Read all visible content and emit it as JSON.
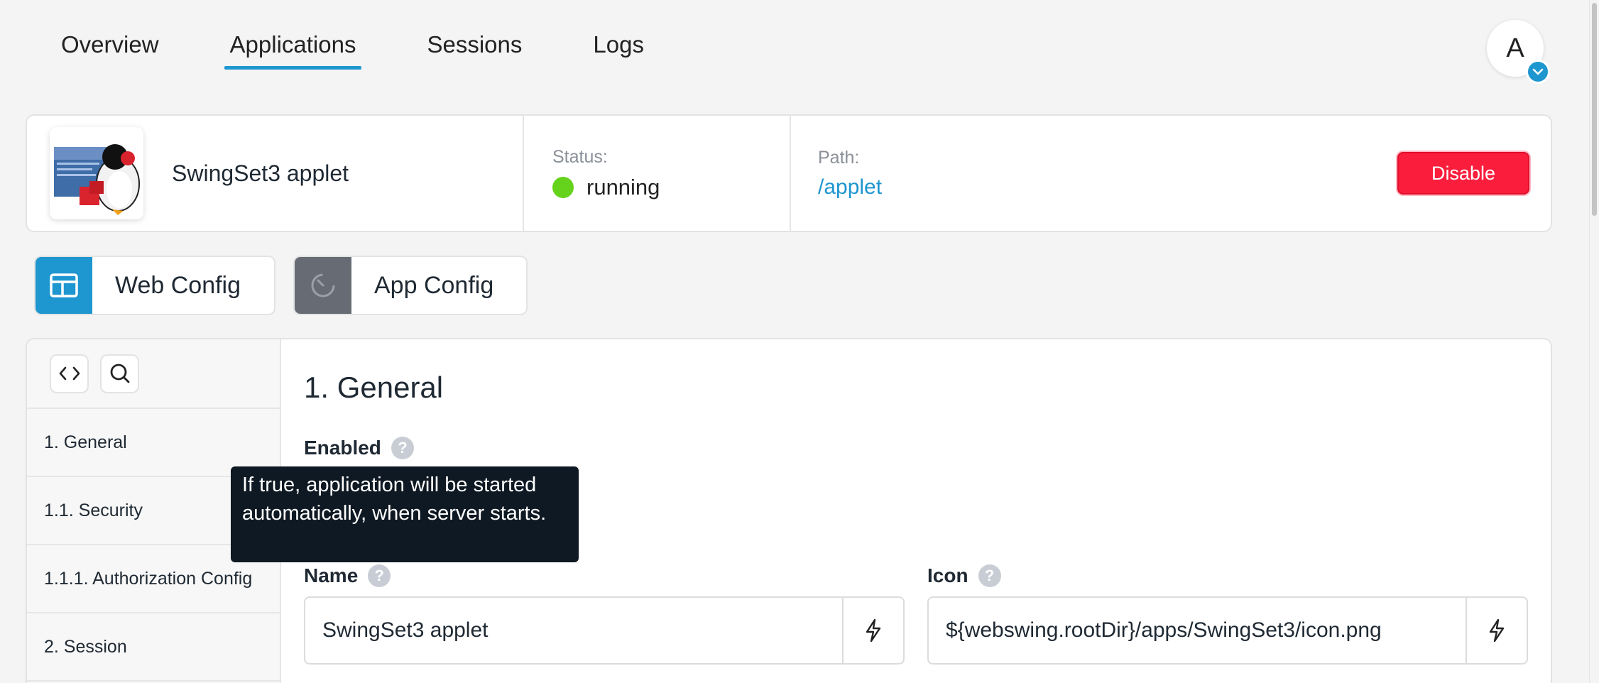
{
  "nav": {
    "tabs": [
      "Overview",
      "Applications",
      "Sessions",
      "Logs"
    ],
    "active_tab": "Applications"
  },
  "user": {
    "avatar_letter": "A"
  },
  "app": {
    "name": "SwingSet3 applet",
    "status_label": "Status:",
    "status_value": "running",
    "path_label": "Path:",
    "path_value": "/applet",
    "disable_label": "Disable"
  },
  "config_tabs": {
    "web": "Web Config",
    "app": "App Config"
  },
  "sidebar": {
    "items": [
      {
        "label": "1. General"
      },
      {
        "label": "1.1. Security"
      },
      {
        "label": "1.1.1. Authorization Config"
      },
      {
        "label": "2. Session"
      }
    ]
  },
  "content": {
    "section_title": "1. General",
    "enabled_label": "Enabled",
    "tooltip": "If true, application will be started automatically, when server starts.",
    "name_label": "Name",
    "name_value": "SwingSet3 applet",
    "icon_label": "Icon",
    "icon_value": "${webswing.rootDir}/apps/SwingSet3/icon.png",
    "help_glyph": "?"
  },
  "colors": {
    "accent": "#1e96cf",
    "danger": "#fa1e3c",
    "running": "#65d31c"
  }
}
